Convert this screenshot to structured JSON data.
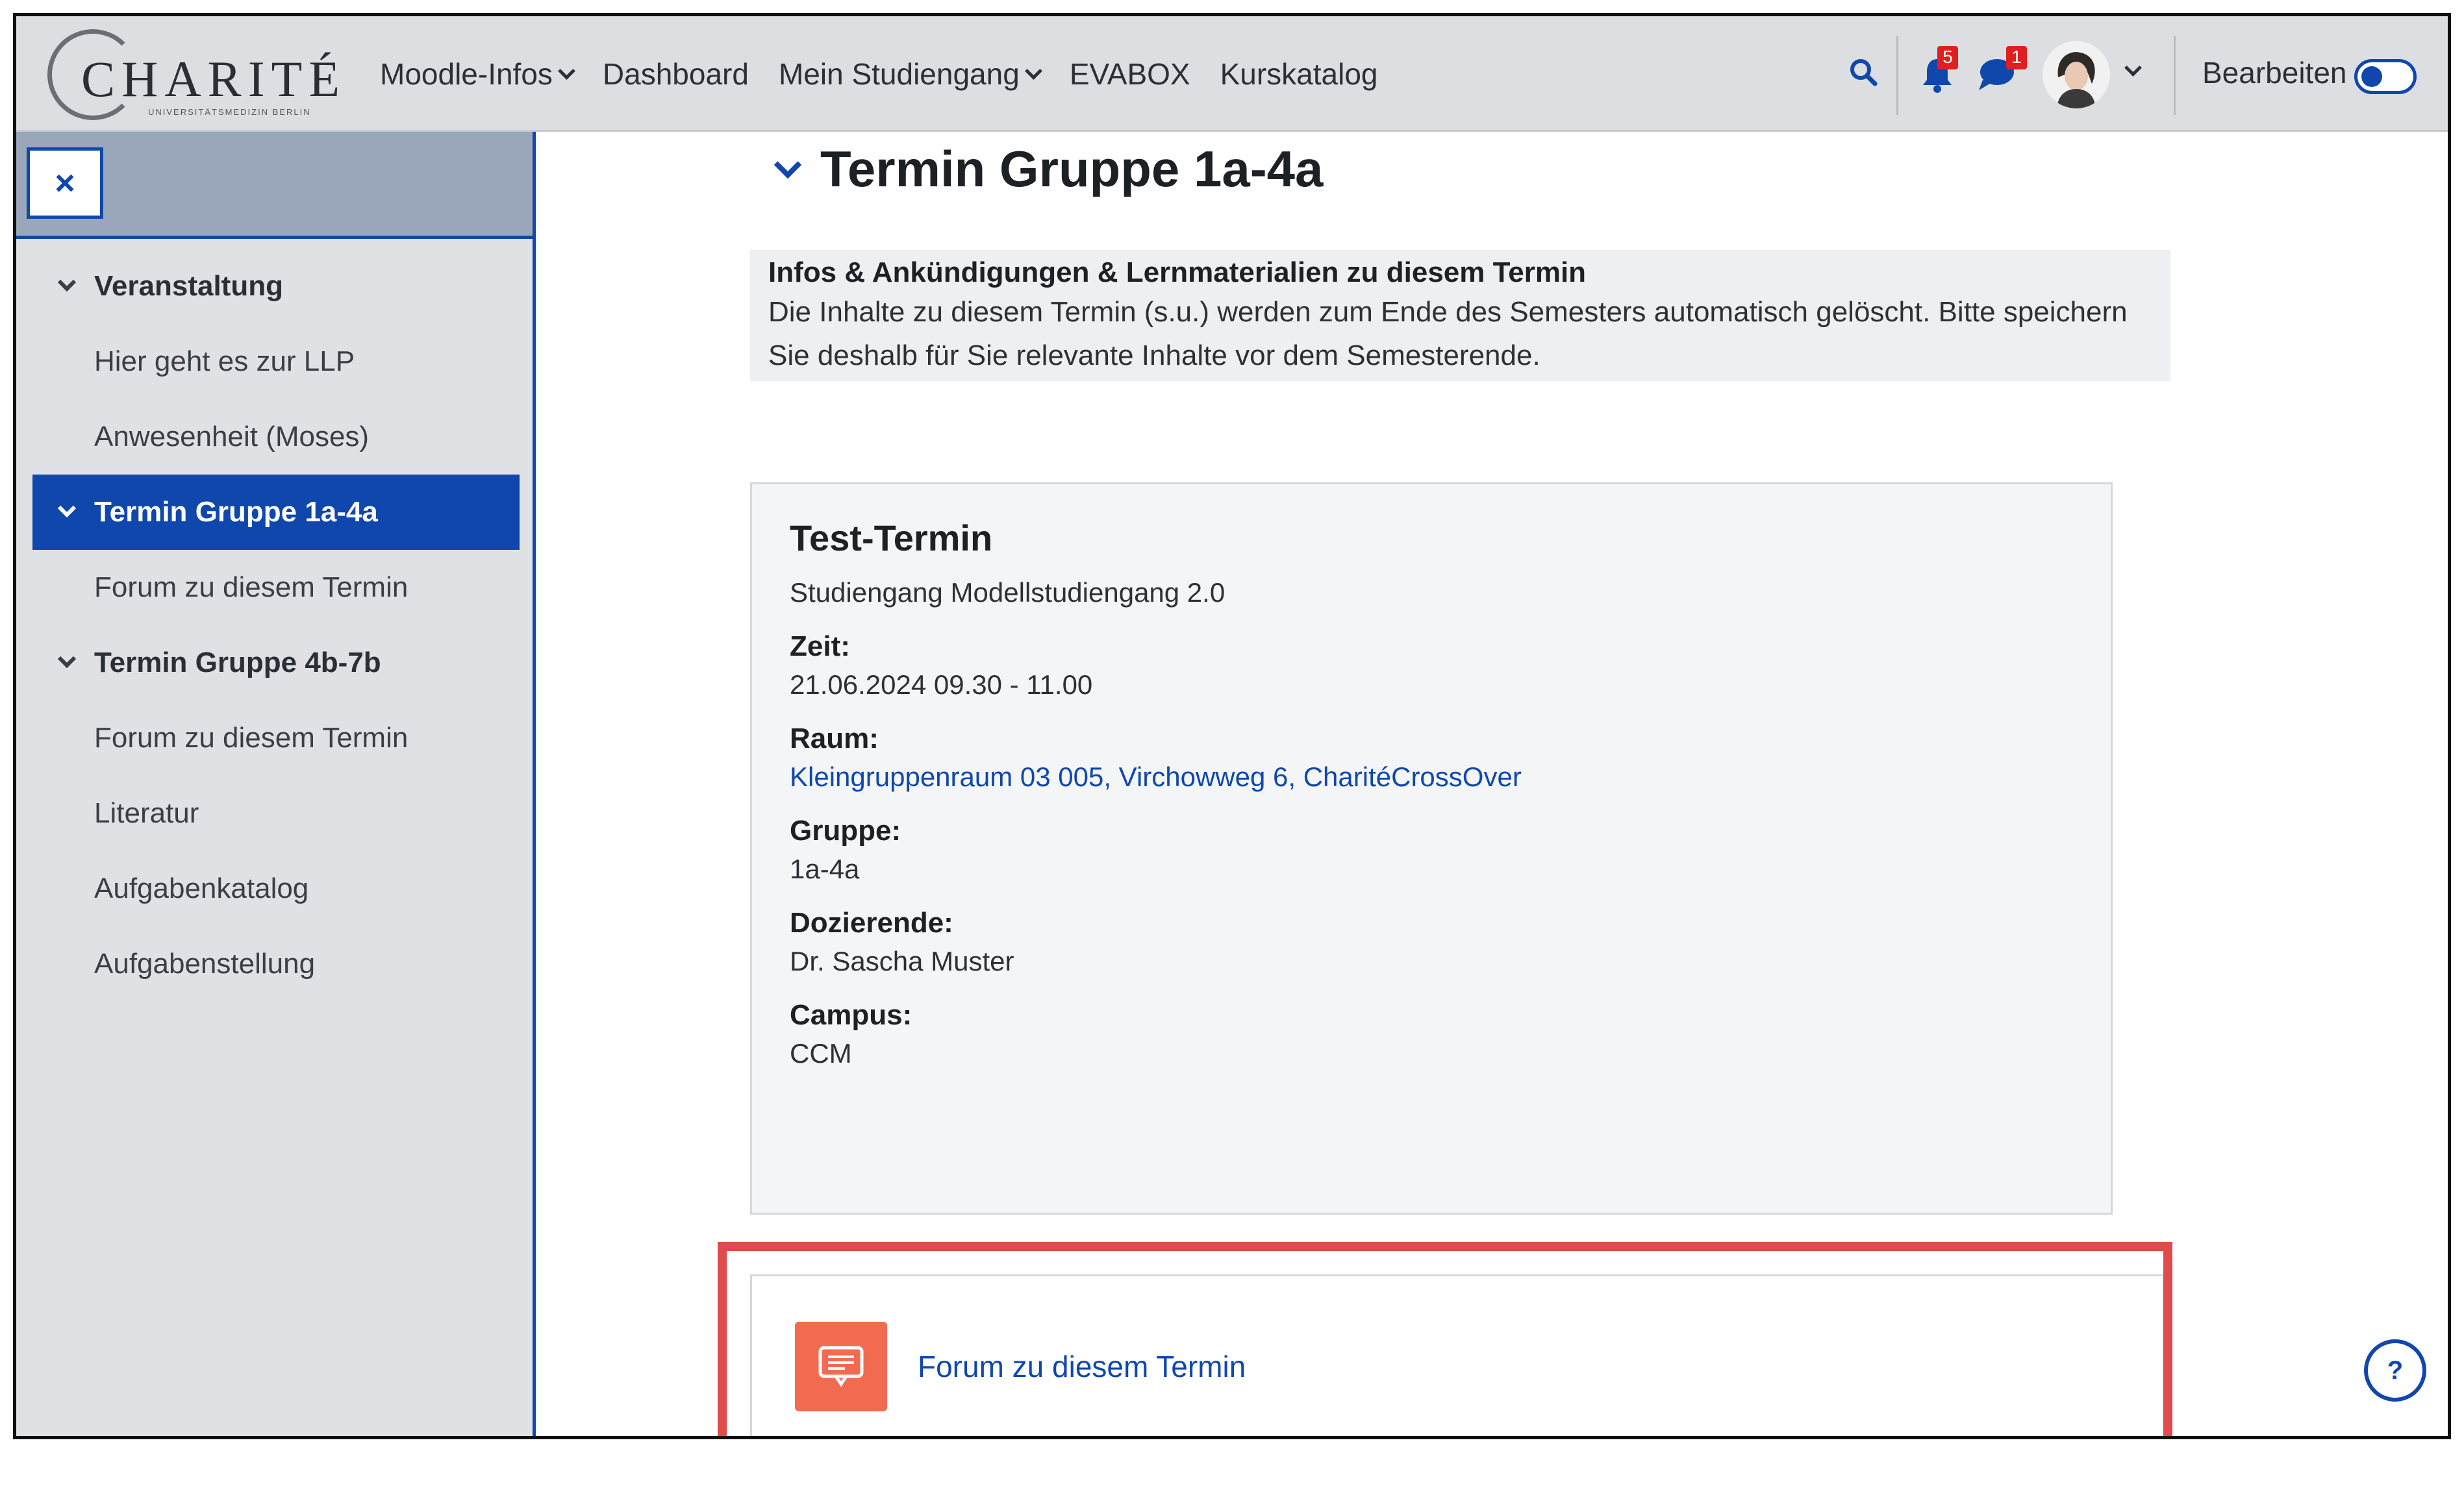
{
  "brand": {
    "name": "CHARITÉ",
    "subline": "UNIVERSITÄTSMEDIZIN BERLIN"
  },
  "nav": {
    "items": [
      {
        "label": "Moodle-Infos",
        "dropdown": true
      },
      {
        "label": "Dashboard",
        "dropdown": false
      },
      {
        "label": "Mein Studiengang",
        "dropdown": true
      },
      {
        "label": "EVABOX",
        "dropdown": false
      },
      {
        "label": "Kurskatalog",
        "dropdown": false
      }
    ],
    "notifications_count": "5",
    "messages_count": "1",
    "edit_label": "Bearbeiten",
    "edit_mode_on": false
  },
  "drawer": {
    "close_icon": "×",
    "items": [
      {
        "label": "Veranstaltung",
        "type": "section"
      },
      {
        "label": "Hier geht es zur LLP",
        "type": "sub"
      },
      {
        "label": "Anwesenheit (Moses)",
        "type": "sub"
      },
      {
        "label": "Termin Gruppe 1a-4a",
        "type": "section-active"
      },
      {
        "label": "Forum zu diesem Termin",
        "type": "sub"
      },
      {
        "label": "Termin Gruppe 4b-7b",
        "type": "section"
      },
      {
        "label": "Forum zu diesem Termin",
        "type": "sub"
      },
      {
        "label": "Literatur",
        "type": "sub"
      },
      {
        "label": "Aufgabenkatalog",
        "type": "sub"
      },
      {
        "label": "Aufgabenstellung",
        "type": "sub"
      }
    ]
  },
  "main": {
    "section_title": "Termin Gruppe 1a-4a",
    "info_title": "Infos & Ankündigungen & Lernmaterialien zu diesem Termin",
    "info_line1": "Die Inhalte zu diesem Termin (s.u.) werden zum Ende des Semesters automatisch gelöscht. Bitte speichern",
    "info_line2": "Sie deshalb für Sie relevante Inhalte vor dem Semesterende.",
    "card": {
      "title": "Test-Termin",
      "subtitle": "Studiengang Modellstudiengang 2.0",
      "time_label": "Zeit:",
      "time_value": "21.06.2024 09.30 - 11.00",
      "room_label": "Raum:",
      "room_value": "Kleingruppenraum 03 005, Virchowweg 6, CharitéCrossOver",
      "group_label": "Gruppe:",
      "group_value": "1a-4a",
      "lecturer_label": "Dozierende:",
      "lecturer_value": "Dr. Sascha Muster",
      "campus_label": "Campus:",
      "campus_value": "CCM"
    },
    "forum_link": "Forum zu diesem Termin"
  },
  "help_label": "?",
  "colors": {
    "accent": "#0f47ad",
    "highlight": "#e14b4b",
    "forum_icon": "#f26b51"
  }
}
